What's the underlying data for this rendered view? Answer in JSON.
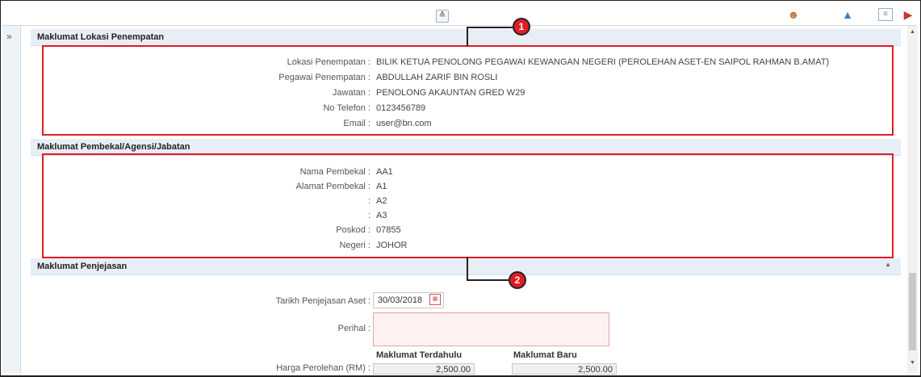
{
  "toolbar": {
    "collapse_icon": "double-chevron-up",
    "icons": [
      "user-help-icon",
      "lock-icon",
      "list-icon",
      "exit-icon"
    ]
  },
  "sidebar": {
    "expand_icon": "double-chevron-right"
  },
  "sections": {
    "lokasi": {
      "title": "Maklumat Lokasi Penempatan",
      "fields": [
        {
          "label": "Lokasi Penempatan :",
          "value": "BILIK KETUA PENOLONG PEGAWAI KEWANGAN NEGERI (PEROLEHAN ASET-EN SAIPOL RAHMAN B.AMAT)"
        },
        {
          "label": "Pegawai Penempatan :",
          "value": "ABDULLAH ZARIF BIN ROSLI"
        },
        {
          "label": "Jawatan :",
          "value": "PENOLONG AKAUNTAN GRED W29"
        },
        {
          "label": "No Telefon :",
          "value": "0123456789"
        },
        {
          "label": "Email :",
          "value": "user@bn.com"
        }
      ]
    },
    "pembekal": {
      "title": "Maklumat Pembekal/Agensi/Jabatan",
      "fields": [
        {
          "label": "Nama Pembekal :",
          "value": "AA1"
        },
        {
          "label": "Alamat Pembekal :",
          "value": "A1"
        },
        {
          "label": ":",
          "value": "A2"
        },
        {
          "label": ":",
          "value": "A3"
        },
        {
          "label": "Poskod :",
          "value": "07855"
        },
        {
          "label": "Negeri :",
          "value": "JOHOR"
        }
      ]
    },
    "penjejasan": {
      "title": "Maklumat Penjejasan",
      "tarikh_label": "Tarikh Penjejasan Aset :",
      "tarikh_value": "30/03/2018",
      "perihal_label": "Perihal :",
      "col_terdahulu": "Maklumat Terdahulu",
      "col_baru": "Maklumat Baru",
      "harga_label": "Harga Perolehan (RM) :",
      "harga_terdahulu": "2,500.00",
      "harga_baru": "2,500.00"
    }
  },
  "callouts": [
    "1",
    "2"
  ],
  "colors": {
    "highlight": "#e31b23",
    "header_bg": "#e8eef5"
  }
}
